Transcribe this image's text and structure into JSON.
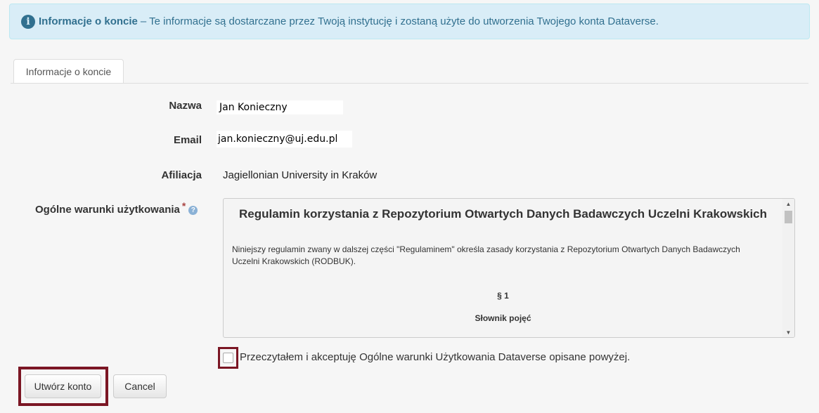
{
  "alert": {
    "title": "Informacje o koncie",
    "text": "– Te informacje są dostarczane przez Twoją instytucję i zostaną użyte do utworzenia Twojego konta Dataverse.",
    "icon": "info-circle-icon"
  },
  "tab": {
    "label": "Informacje o koncie"
  },
  "fields": {
    "name": {
      "label": "Nazwa",
      "value": "Jan Konieczny"
    },
    "email": {
      "label": "Email",
      "value": "jan.konieczny@uj.edu.pl"
    },
    "affiliation": {
      "label": "Afiliacja",
      "value": "Jagiellonian University in Kraków"
    },
    "terms": {
      "label": "Ogólne warunki użytkowania",
      "required_mark": "*"
    }
  },
  "terms_box": {
    "title": "Regulamin korzystania z Repozytorium Otwartych Danych Badawczych Uczelni Krakowskich",
    "paragraph": "Niniejszy regulamin zwany w dalszej części \"Regulaminem\" określa zasady korzystania z Repozytorium Otwartych Danych Badawczych Uczelni Krakowskich (RODBUK).",
    "section_number": "§ 1",
    "section_title": "Słownik pojęć"
  },
  "accept": {
    "label": "Przeczytałem i akceptuję Ogólne warunki Użytkowania Dataverse opisane powyżej.",
    "checked": false
  },
  "buttons": {
    "create": "Utwórz konto",
    "cancel": "Cancel"
  },
  "colors": {
    "alert_bg": "#d9edf7",
    "alert_text": "#31708f",
    "highlight": "#7b1624",
    "required": "#a94442"
  }
}
